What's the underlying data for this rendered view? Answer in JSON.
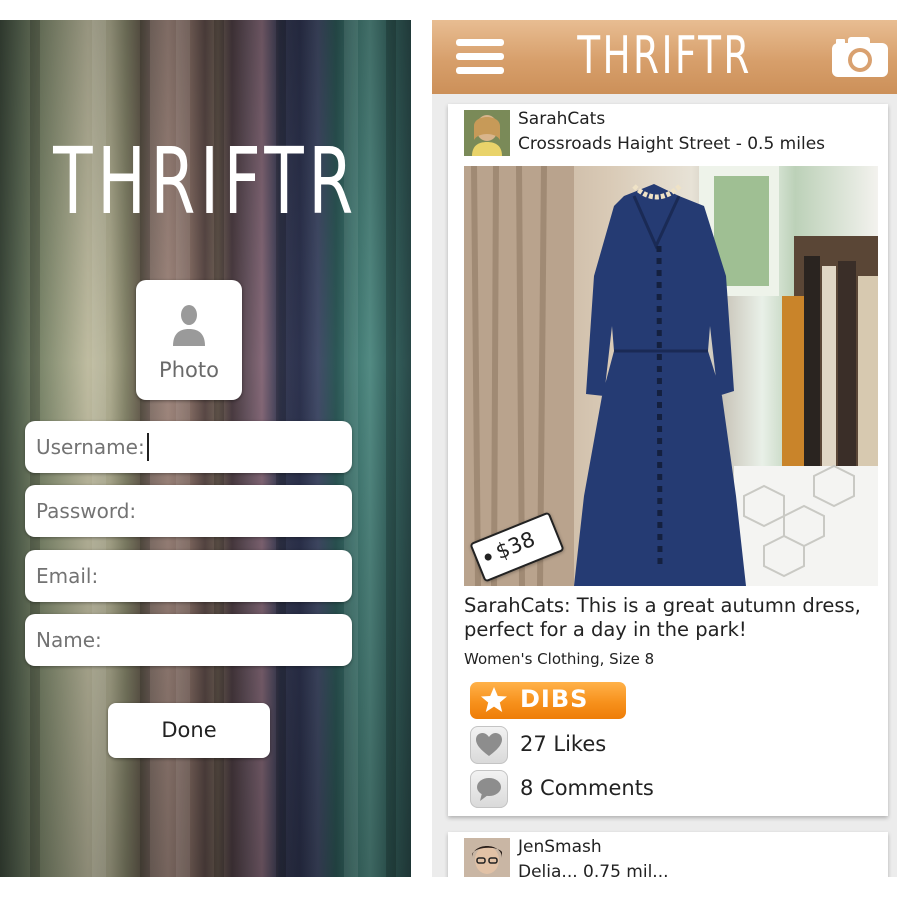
{
  "signup": {
    "logo": "THRIFTR",
    "photo_label": "Photo",
    "fields": [
      {
        "placeholder": "Username:"
      },
      {
        "placeholder": "Password:"
      },
      {
        "placeholder": "Email:"
      },
      {
        "placeholder": "Name:"
      }
    ],
    "done_label": "Done"
  },
  "feed": {
    "logo": "THRIFTR",
    "icons": {
      "menu": "hamburger-menu-icon",
      "camera": "camera-icon"
    },
    "colors": {
      "navbar": "#d79f6b",
      "dibs": "#f7911c"
    },
    "posts": [
      {
        "username": "SarahCats",
        "location": "Crossroads Haight Street - 0.5 miles",
        "price": "$38",
        "caption": "SarahCats: This is a great autumn dress, perfect for a day in the park!",
        "category": "Women's Clothing, Size 8",
        "dibs_label": "DIBS",
        "likes": "27 Likes",
        "comments": "8 Comments"
      },
      {
        "username": "JenSmash",
        "location": "Delia... 0.75 mil..."
      }
    ]
  }
}
